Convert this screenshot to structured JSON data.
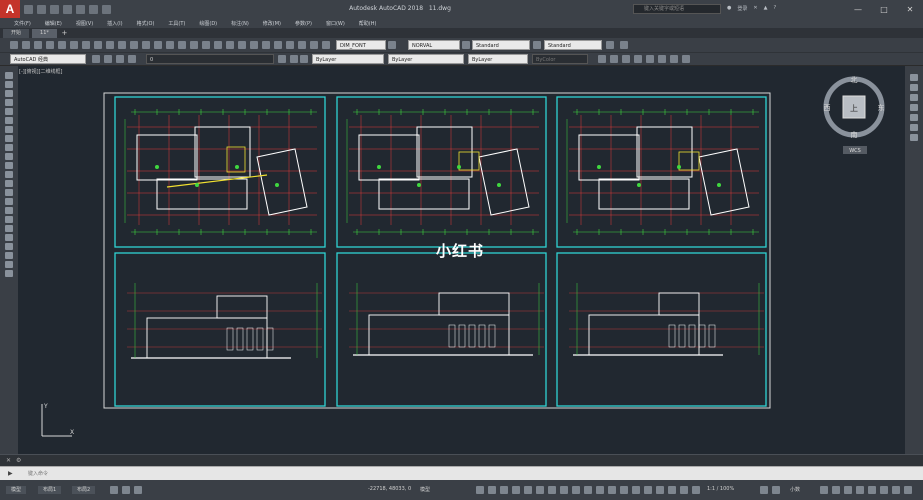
{
  "app": {
    "title": "Autodesk AutoCAD 2018",
    "filename": "11.dwg",
    "search_placeholder": "键入关键字或短语",
    "user_label": "登录",
    "logo_letter": "A"
  },
  "menu": {
    "items": [
      "文件(F)",
      "编辑(E)",
      "视图(V)",
      "插入(I)",
      "格式(O)",
      "工具(T)",
      "绘图(D)",
      "标注(N)",
      "修改(M)",
      "参数(P)",
      "窗口(W)",
      "帮助(H)"
    ]
  },
  "tabs": {
    "items": [
      "开始",
      "11*"
    ]
  },
  "toolbar": {
    "text_style": "DIM_FONT",
    "dim_style": "NORVAL",
    "table_style": "Standard",
    "multileader_style": "Standard",
    "workspace": "AutoCAD 经典",
    "layer": "0",
    "color": "ByLayer",
    "linetype": "ByLayer",
    "lineweight": "ByLayer",
    "plotstyle": "ByColor"
  },
  "viewport": {
    "label": "[-][俯视][二维线框]"
  },
  "viewcube": {
    "north": "北",
    "south": "南",
    "east": "东",
    "west": "西",
    "top": "上",
    "wcs": "WCS"
  },
  "watermark": "小红书",
  "command": {
    "placeholder": "键入命令"
  },
  "status": {
    "model_tab": "模型",
    "layout1": "布局1",
    "layout2": "布局2",
    "coords": "-22718, 48033, 0",
    "mode": "模型",
    "zoom": "1:1 / 100%",
    "scale_label": "小数"
  },
  "colors": {
    "background": "#212830",
    "frame": "#2fd3d3",
    "wall": "#ffffff",
    "grid": "#e23a3a",
    "dim": "#3fd83f",
    "accent": "#f0e030"
  }
}
